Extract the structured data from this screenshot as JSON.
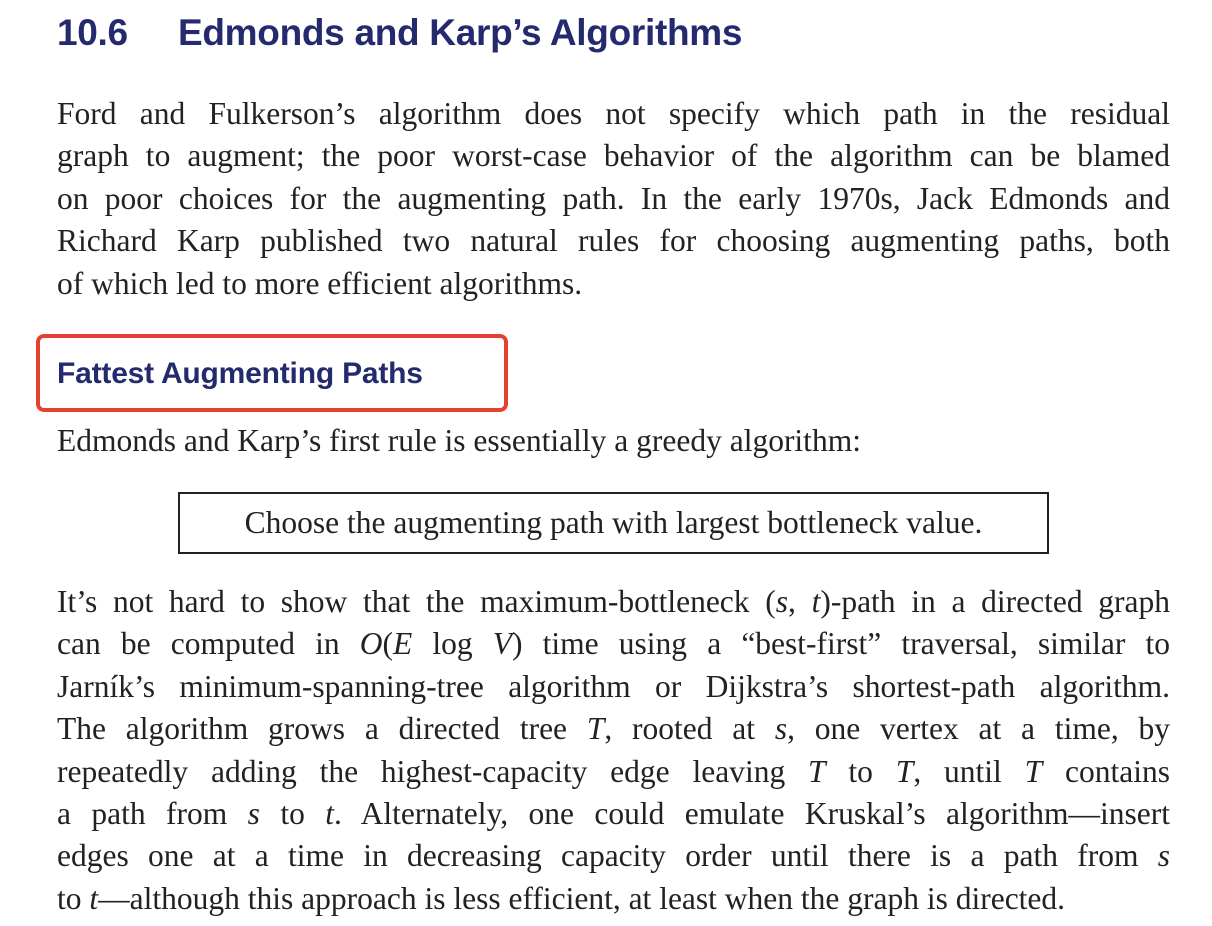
{
  "heading": {
    "number": "10.6",
    "title": "Edmonds and Karp’s Algorithms"
  },
  "intro": {
    "lines": [
      "Ford and Fulkerson’s algorithm does not specify which path in the residual",
      "graph to augment; the poor worst-case behavior of the algorithm can be blamed",
      "on poor choices for the augmenting path.  In the early 1970s, Jack Edmonds and",
      "Richard Karp published two natural rules for choosing augmenting paths, both",
      "of which led to more efficient algorithms."
    ]
  },
  "subsection": {
    "title": "Fattest Augmenting Paths",
    "highlight_color": "#e4412f"
  },
  "rule_intro": "Edmonds and Karp’s first rule is essentially a greedy algorithm:",
  "rule_box": "Choose the augmenting path with largest bottleneck value.",
  "body": {
    "l1": {
      "a": "It’s not hard to show that the maximum-bottleneck (",
      "s": "s",
      "comma": ", ",
      "t": "t",
      "b": ")-path in a directed graph"
    },
    "l2": {
      "a": "can be computed in ",
      "O": "O",
      "paren_open": "(",
      "E": "E",
      "log": " log ",
      "V": "V",
      "b": ") time using a “best-first” traversal, similar to"
    },
    "l3": "Jarník’s minimum-spanning-tree algorithm or Dijkstra’s shortest-path algorithm.",
    "l4": {
      "a": "The algorithm grows a directed tree ",
      "T": "T",
      "b": ", rooted at ",
      "s": "s",
      "c": ", one vertex at a time, by"
    },
    "l5": {
      "a": "repeatedly adding the highest-capacity edge leaving ",
      "T1": "T",
      "b": " to ",
      "T2": "T",
      "c": ", until ",
      "T3": "T",
      "d": " contains"
    },
    "l6": {
      "a": "a path from ",
      "s": "s",
      "b": " to ",
      "t": "t",
      "c": ".  Alternately, one could emulate Kruskal’s algorithm—insert"
    },
    "l7": {
      "a": "edges one at a time in decreasing capacity order until there is a path from ",
      "s": "s"
    },
    "l8": {
      "a": "to ",
      "t": "t",
      "b": "—although this approach is less efficient, at least when the graph is directed."
    }
  }
}
